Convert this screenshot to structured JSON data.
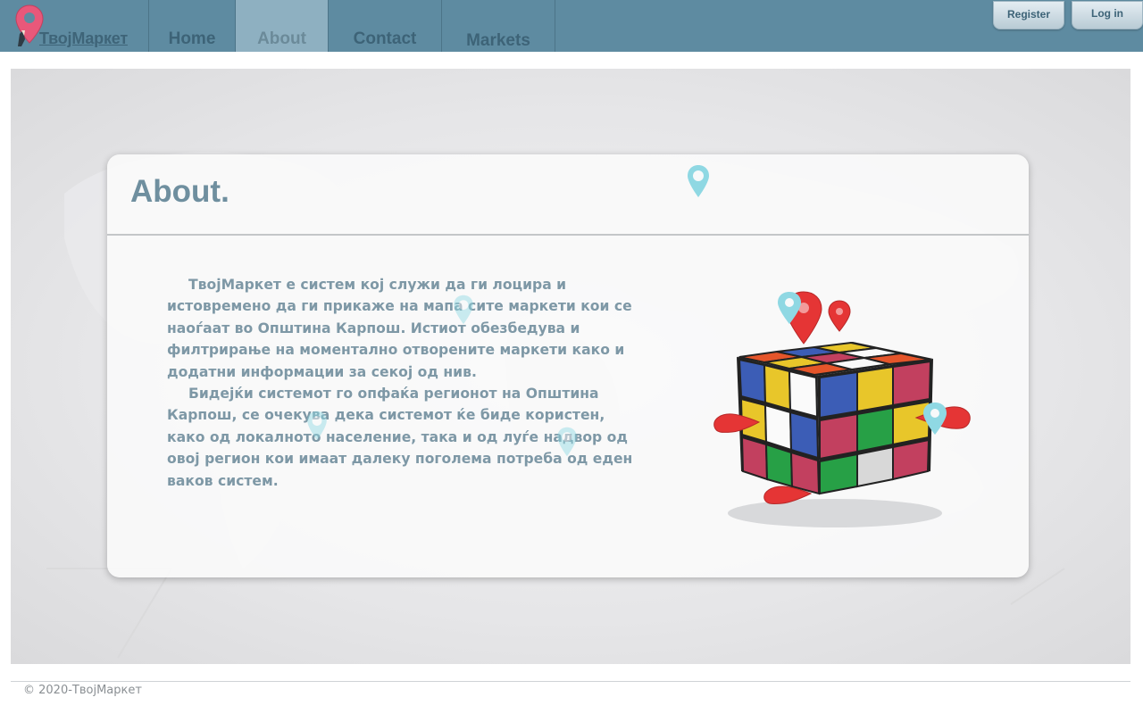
{
  "brand": {
    "name": "ТвојМаркет",
    "icon": "map-pin-icon"
  },
  "nav": {
    "items": [
      {
        "label": "Home"
      },
      {
        "label": "About",
        "active": true
      },
      {
        "label": "Contact"
      },
      {
        "label": "Markets"
      }
    ]
  },
  "auth": {
    "register_label": "Register",
    "login_label": "Log in"
  },
  "about": {
    "title": "About.",
    "paragraphs": [
      "ТвојМаркет е систем кој служи да ги лоцира и истовремено да ги прикаже на мапа сите маркети кои се наоѓаат во Општина Карпош. Истиот обезбедува и филтрирање на моментално отворените маркети како и додатни информации за секој од нив.",
      "Бидејќи системот го опфаќа регионот на Општина Карпош, се очекува дека системот ќе биде користен, како од локалното население, така и од луѓе надвор од овој регион кои имаат далеку поголема потреба од еден ваков систем."
    ],
    "illustration": "rubiks-cube-with-map-pins"
  },
  "colors": {
    "navbar": "#5e8ba1",
    "nav_active": "#8eb0c1",
    "accent_text": "#6f8f9f",
    "pin_red": "#e53535",
    "pin_cyan": "#8fd8e3"
  },
  "footer": {
    "text": "© 2020-ТвојМаркет"
  }
}
